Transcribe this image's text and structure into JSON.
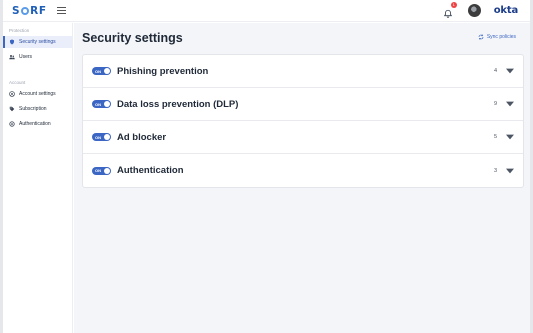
{
  "brand": {
    "logo_text_left": "S",
    "logo_text_right": "RF",
    "partner_logo": "okta"
  },
  "header": {
    "notification_count": "1"
  },
  "sidebar": {
    "sections": [
      {
        "label": "Protection"
      },
      {
        "label": "Account"
      }
    ],
    "items": [
      {
        "label": "Security settings",
        "icon": "shield-icon"
      },
      {
        "label": "Users",
        "icon": "users-icon"
      },
      {
        "label": "Account settings",
        "icon": "account-circle-icon"
      },
      {
        "label": "Subscription",
        "icon": "tag-icon"
      },
      {
        "label": "Authentication",
        "icon": "auth-icon"
      }
    ]
  },
  "main": {
    "title": "Security settings",
    "sync_label": "Sync policies",
    "policies": [
      {
        "toggle": "ON",
        "name": "Phishing prevention",
        "count": "4"
      },
      {
        "toggle": "ON",
        "name": "Data loss prevention (DLP)",
        "count": "9"
      },
      {
        "toggle": "ON",
        "name": "Ad blocker",
        "count": "5"
      },
      {
        "toggle": "ON",
        "name": "Authentication",
        "count": "3"
      }
    ]
  },
  "colors": {
    "accent": "#3b66c4",
    "logo": "#1f5fb8",
    "badge": "#ef4444"
  }
}
